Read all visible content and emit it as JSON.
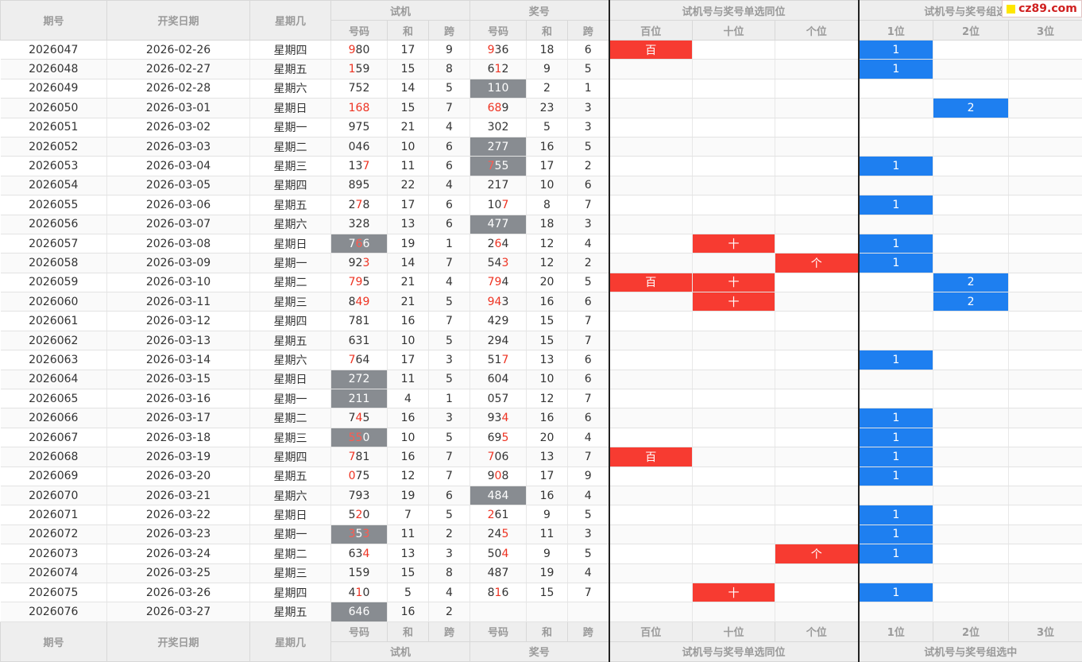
{
  "header": {
    "period": "期号",
    "date": "开奖日期",
    "weekday": "星期几",
    "trial_group": "试机",
    "draw_group": "奖号",
    "single_group": "试机号与奖号单选同位",
    "combo_group": "试机号与奖号组选中",
    "sub_code": "号码",
    "sub_sum": "和",
    "sub_span": "跨",
    "pos_hundreds": "百位",
    "pos_tens": "十位",
    "pos_units": "个位",
    "combo_1": "1位",
    "combo_2": "2位",
    "combo_3": "3位"
  },
  "watermark": "cz89.com",
  "colors": {
    "red": "#f73b31",
    "blue": "#1e7ff0",
    "gray": "#888c91",
    "highlight": "#ee3322"
  },
  "rows": [
    {
      "period": "2026047",
      "date": "2026-02-26",
      "weekday": "星期四",
      "trial": "980",
      "thl": [
        0
      ],
      "tsum": "17",
      "tspan": "9",
      "draw": "936",
      "dhl": [
        0
      ],
      "dsum": "18",
      "dspan": "6",
      "bai": "百",
      "shi": "",
      "ge": "",
      "c1": "1",
      "c2": "",
      "c3": "",
      "tdark": false,
      "ddark": false
    },
    {
      "period": "2026048",
      "date": "2026-02-27",
      "weekday": "星期五",
      "trial": "159",
      "thl": [
        0
      ],
      "tsum": "15",
      "tspan": "8",
      "draw": "612",
      "dhl": [
        1
      ],
      "dsum": "9",
      "dspan": "5",
      "bai": "",
      "shi": "",
      "ge": "",
      "c1": "1",
      "c2": "",
      "c3": "",
      "tdark": false,
      "ddark": false
    },
    {
      "period": "2026049",
      "date": "2026-02-28",
      "weekday": "星期六",
      "trial": "752",
      "thl": [],
      "tsum": "14",
      "tspan": "5",
      "draw": "110",
      "dhl": [],
      "dsum": "2",
      "dspan": "1",
      "bai": "",
      "shi": "",
      "ge": "",
      "c1": "",
      "c2": "",
      "c3": "",
      "tdark": false,
      "ddark": true
    },
    {
      "period": "2026050",
      "date": "2026-03-01",
      "weekday": "星期日",
      "trial": "168",
      "thl": [
        0,
        1,
        2
      ],
      "tsum": "15",
      "tspan": "7",
      "draw": "689",
      "dhl": [
        0,
        1
      ],
      "dsum": "23",
      "dspan": "3",
      "bai": "",
      "shi": "",
      "ge": "",
      "c1": "",
      "c2": "2",
      "c3": "",
      "tdark": false,
      "ddark": false
    },
    {
      "period": "2026051",
      "date": "2026-03-02",
      "weekday": "星期一",
      "trial": "975",
      "thl": [],
      "tsum": "21",
      "tspan": "4",
      "draw": "302",
      "dhl": [],
      "dsum": "5",
      "dspan": "3",
      "bai": "",
      "shi": "",
      "ge": "",
      "c1": "",
      "c2": "",
      "c3": "",
      "tdark": false,
      "ddark": false
    },
    {
      "period": "2026052",
      "date": "2026-03-03",
      "weekday": "星期二",
      "trial": "046",
      "thl": [],
      "tsum": "10",
      "tspan": "6",
      "draw": "277",
      "dhl": [],
      "dsum": "16",
      "dspan": "5",
      "bai": "",
      "shi": "",
      "ge": "",
      "c1": "",
      "c2": "",
      "c3": "",
      "tdark": false,
      "ddark": true
    },
    {
      "period": "2026053",
      "date": "2026-03-04",
      "weekday": "星期三",
      "trial": "137",
      "thl": [
        2
      ],
      "tsum": "11",
      "tspan": "6",
      "draw": "755",
      "dhl": [
        0
      ],
      "dsum": "17",
      "dspan": "2",
      "bai": "",
      "shi": "",
      "ge": "",
      "c1": "1",
      "c2": "",
      "c3": "",
      "tdark": false,
      "ddark": true
    },
    {
      "period": "2026054",
      "date": "2026-03-05",
      "weekday": "星期四",
      "trial": "895",
      "thl": [],
      "tsum": "22",
      "tspan": "4",
      "draw": "217",
      "dhl": [],
      "dsum": "10",
      "dspan": "6",
      "bai": "",
      "shi": "",
      "ge": "",
      "c1": "",
      "c2": "",
      "c3": "",
      "tdark": false,
      "ddark": false
    },
    {
      "period": "2026055",
      "date": "2026-03-06",
      "weekday": "星期五",
      "trial": "278",
      "thl": [
        1
      ],
      "tsum": "17",
      "tspan": "6",
      "draw": "107",
      "dhl": [
        2
      ],
      "dsum": "8",
      "dspan": "7",
      "bai": "",
      "shi": "",
      "ge": "",
      "c1": "1",
      "c2": "",
      "c3": "",
      "tdark": false,
      "ddark": false
    },
    {
      "period": "2026056",
      "date": "2026-03-07",
      "weekday": "星期六",
      "trial": "328",
      "thl": [],
      "tsum": "13",
      "tspan": "6",
      "draw": "477",
      "dhl": [],
      "dsum": "18",
      "dspan": "3",
      "bai": "",
      "shi": "",
      "ge": "",
      "c1": "",
      "c2": "",
      "c3": "",
      "tdark": false,
      "ddark": true
    },
    {
      "period": "2026057",
      "date": "2026-03-08",
      "weekday": "星期日",
      "trial": "766",
      "thl": [
        1
      ],
      "tsum": "19",
      "tspan": "1",
      "draw": "264",
      "dhl": [
        1
      ],
      "dsum": "12",
      "dspan": "4",
      "bai": "",
      "shi": "十",
      "ge": "",
      "c1": "1",
      "c2": "",
      "c3": "",
      "tdark": true,
      "ddark": false
    },
    {
      "period": "2026058",
      "date": "2026-03-09",
      "weekday": "星期一",
      "trial": "923",
      "thl": [
        2
      ],
      "tsum": "14",
      "tspan": "7",
      "draw": "543",
      "dhl": [
        2
      ],
      "dsum": "12",
      "dspan": "2",
      "bai": "",
      "shi": "",
      "ge": "个",
      "c1": "1",
      "c2": "",
      "c3": "",
      "tdark": false,
      "ddark": false
    },
    {
      "period": "2026059",
      "date": "2026-03-10",
      "weekday": "星期二",
      "trial": "795",
      "thl": [
        0,
        1
      ],
      "tsum": "21",
      "tspan": "4",
      "draw": "794",
      "dhl": [
        0,
        1
      ],
      "dsum": "20",
      "dspan": "5",
      "bai": "百",
      "shi": "十",
      "ge": "",
      "c1": "",
      "c2": "2",
      "c3": "",
      "tdark": false,
      "ddark": false
    },
    {
      "period": "2026060",
      "date": "2026-03-11",
      "weekday": "星期三",
      "trial": "849",
      "thl": [
        1,
        2
      ],
      "tsum": "21",
      "tspan": "5",
      "draw": "943",
      "dhl": [
        0,
        1
      ],
      "dsum": "16",
      "dspan": "6",
      "bai": "",
      "shi": "十",
      "ge": "",
      "c1": "",
      "c2": "2",
      "c3": "",
      "tdark": false,
      "ddark": false
    },
    {
      "period": "2026061",
      "date": "2026-03-12",
      "weekday": "星期四",
      "trial": "781",
      "thl": [],
      "tsum": "16",
      "tspan": "7",
      "draw": "429",
      "dhl": [],
      "dsum": "15",
      "dspan": "7",
      "bai": "",
      "shi": "",
      "ge": "",
      "c1": "",
      "c2": "",
      "c3": "",
      "tdark": false,
      "ddark": false
    },
    {
      "period": "2026062",
      "date": "2026-03-13",
      "weekday": "星期五",
      "trial": "631",
      "thl": [],
      "tsum": "10",
      "tspan": "5",
      "draw": "294",
      "dhl": [],
      "dsum": "15",
      "dspan": "7",
      "bai": "",
      "shi": "",
      "ge": "",
      "c1": "",
      "c2": "",
      "c3": "",
      "tdark": false,
      "ddark": false
    },
    {
      "period": "2026063",
      "date": "2026-03-14",
      "weekday": "星期六",
      "trial": "764",
      "thl": [
        0
      ],
      "tsum": "17",
      "tspan": "3",
      "draw": "517",
      "dhl": [
        2
      ],
      "dsum": "13",
      "dspan": "6",
      "bai": "",
      "shi": "",
      "ge": "",
      "c1": "1",
      "c2": "",
      "c3": "",
      "tdark": false,
      "ddark": false
    },
    {
      "period": "2026064",
      "date": "2026-03-15",
      "weekday": "星期日",
      "trial": "272",
      "thl": [],
      "tsum": "11",
      "tspan": "5",
      "draw": "604",
      "dhl": [],
      "dsum": "10",
      "dspan": "6",
      "bai": "",
      "shi": "",
      "ge": "",
      "c1": "",
      "c2": "",
      "c3": "",
      "tdark": true,
      "ddark": false
    },
    {
      "period": "2026065",
      "date": "2026-03-16",
      "weekday": "星期一",
      "trial": "211",
      "thl": [],
      "tsum": "4",
      "tspan": "1",
      "draw": "057",
      "dhl": [],
      "dsum": "12",
      "dspan": "7",
      "bai": "",
      "shi": "",
      "ge": "",
      "c1": "",
      "c2": "",
      "c3": "",
      "tdark": true,
      "ddark": false
    },
    {
      "period": "2026066",
      "date": "2026-03-17",
      "weekday": "星期二",
      "trial": "745",
      "thl": [
        1
      ],
      "tsum": "16",
      "tspan": "3",
      "draw": "934",
      "dhl": [
        2
      ],
      "dsum": "16",
      "dspan": "6",
      "bai": "",
      "shi": "",
      "ge": "",
      "c1": "1",
      "c2": "",
      "c3": "",
      "tdark": false,
      "ddark": false
    },
    {
      "period": "2026067",
      "date": "2026-03-18",
      "weekday": "星期三",
      "trial": "550",
      "thl": [
        0,
        1
      ],
      "tsum": "10",
      "tspan": "5",
      "draw": "695",
      "dhl": [
        2
      ],
      "dsum": "20",
      "dspan": "4",
      "bai": "",
      "shi": "",
      "ge": "",
      "c1": "1",
      "c2": "",
      "c3": "",
      "tdark": true,
      "ddark": false
    },
    {
      "period": "2026068",
      "date": "2026-03-19",
      "weekday": "星期四",
      "trial": "781",
      "thl": [
        0
      ],
      "tsum": "16",
      "tspan": "7",
      "draw": "706",
      "dhl": [
        0
      ],
      "dsum": "13",
      "dspan": "7",
      "bai": "百",
      "shi": "",
      "ge": "",
      "c1": "1",
      "c2": "",
      "c3": "",
      "tdark": false,
      "ddark": false
    },
    {
      "period": "2026069",
      "date": "2026-03-20",
      "weekday": "星期五",
      "trial": "075",
      "thl": [
        0
      ],
      "tsum": "12",
      "tspan": "7",
      "draw": "908",
      "dhl": [
        1
      ],
      "dsum": "17",
      "dspan": "9",
      "bai": "",
      "shi": "",
      "ge": "",
      "c1": "1",
      "c2": "",
      "c3": "",
      "tdark": false,
      "ddark": false
    },
    {
      "period": "2026070",
      "date": "2026-03-21",
      "weekday": "星期六",
      "trial": "793",
      "thl": [],
      "tsum": "19",
      "tspan": "6",
      "draw": "484",
      "dhl": [],
      "dsum": "16",
      "dspan": "4",
      "bai": "",
      "shi": "",
      "ge": "",
      "c1": "",
      "c2": "",
      "c3": "",
      "tdark": false,
      "ddark": true
    },
    {
      "period": "2026071",
      "date": "2026-03-22",
      "weekday": "星期日",
      "trial": "520",
      "thl": [
        1
      ],
      "tsum": "7",
      "tspan": "5",
      "draw": "261",
      "dhl": [
        0
      ],
      "dsum": "9",
      "dspan": "5",
      "bai": "",
      "shi": "",
      "ge": "",
      "c1": "1",
      "c2": "",
      "c3": "",
      "tdark": false,
      "ddark": false
    },
    {
      "period": "2026072",
      "date": "2026-03-23",
      "weekday": "星期一",
      "trial": "353",
      "thl": [
        0,
        2
      ],
      "tsum": "11",
      "tspan": "2",
      "draw": "245",
      "dhl": [
        2
      ],
      "dsum": "11",
      "dspan": "3",
      "bai": "",
      "shi": "",
      "ge": "",
      "c1": "1",
      "c2": "",
      "c3": "",
      "tdark": true,
      "ddark": false
    },
    {
      "period": "2026073",
      "date": "2026-03-24",
      "weekday": "星期二",
      "trial": "634",
      "thl": [
        2
      ],
      "tsum": "13",
      "tspan": "3",
      "draw": "504",
      "dhl": [
        2
      ],
      "dsum": "9",
      "dspan": "5",
      "bai": "",
      "shi": "",
      "ge": "个",
      "c1": "1",
      "c2": "",
      "c3": "",
      "tdark": false,
      "ddark": false
    },
    {
      "period": "2026074",
      "date": "2026-03-25",
      "weekday": "星期三",
      "trial": "159",
      "thl": [],
      "tsum": "15",
      "tspan": "8",
      "draw": "487",
      "dhl": [],
      "dsum": "19",
      "dspan": "4",
      "bai": "",
      "shi": "",
      "ge": "",
      "c1": "",
      "c2": "",
      "c3": "",
      "tdark": false,
      "ddark": false
    },
    {
      "period": "2026075",
      "date": "2026-03-26",
      "weekday": "星期四",
      "trial": "410",
      "thl": [
        1
      ],
      "tsum": "5",
      "tspan": "4",
      "draw": "816",
      "dhl": [
        1
      ],
      "dsum": "15",
      "dspan": "7",
      "bai": "",
      "shi": "十",
      "ge": "",
      "c1": "1",
      "c2": "",
      "c3": "",
      "tdark": false,
      "ddark": false
    },
    {
      "period": "2026076",
      "date": "2026-03-27",
      "weekday": "星期五",
      "trial": "646",
      "thl": [],
      "tsum": "16",
      "tspan": "2",
      "draw": "",
      "dhl": [],
      "dsum": "",
      "dspan": "",
      "bai": "",
      "shi": "",
      "ge": "",
      "c1": "",
      "c2": "",
      "c3": "",
      "tdark": true,
      "ddark": false
    }
  ]
}
